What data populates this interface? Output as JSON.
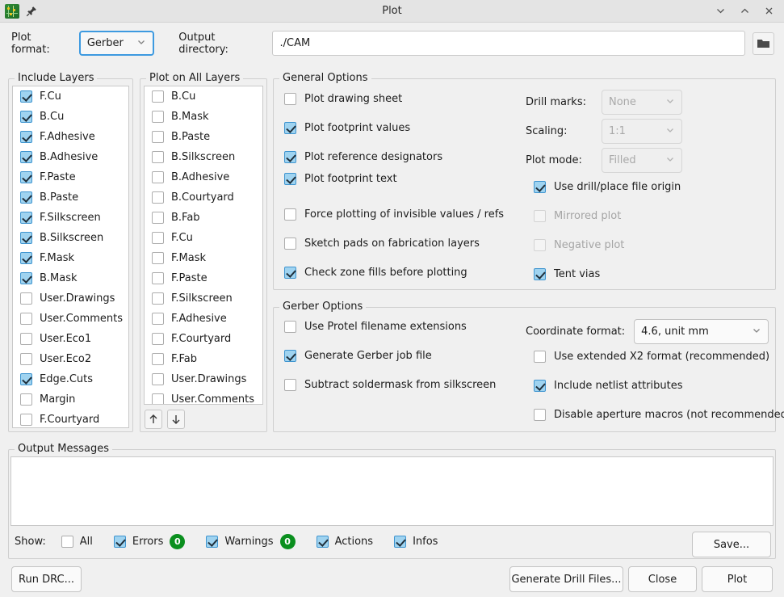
{
  "window": {
    "title": "Plot",
    "app_icon": "pcb-board-icon",
    "pin_icon": "pin-icon",
    "minimize_label": "chevron-down-icon",
    "maximize_label": "chevron-up-icon",
    "close_label": "close-icon"
  },
  "toprow": {
    "plot_format_label": "Plot format:",
    "plot_format_value": "Gerber",
    "output_dir_label": "Output directory:",
    "output_dir_value": "./CAM",
    "browse_icon": "folder-icon"
  },
  "include_layers": {
    "title": "Include Layers",
    "items": [
      {
        "label": "F.Cu",
        "checked": true
      },
      {
        "label": "B.Cu",
        "checked": true
      },
      {
        "label": "F.Adhesive",
        "checked": true
      },
      {
        "label": "B.Adhesive",
        "checked": true
      },
      {
        "label": "F.Paste",
        "checked": true
      },
      {
        "label": "B.Paste",
        "checked": true
      },
      {
        "label": "F.Silkscreen",
        "checked": true
      },
      {
        "label": "B.Silkscreen",
        "checked": true
      },
      {
        "label": "F.Mask",
        "checked": true
      },
      {
        "label": "B.Mask",
        "checked": true
      },
      {
        "label": "User.Drawings",
        "checked": false
      },
      {
        "label": "User.Comments",
        "checked": false
      },
      {
        "label": "User.Eco1",
        "checked": false
      },
      {
        "label": "User.Eco2",
        "checked": false
      },
      {
        "label": "Edge.Cuts",
        "checked": true
      },
      {
        "label": "Margin",
        "checked": false
      },
      {
        "label": "F.Courtyard",
        "checked": false
      }
    ]
  },
  "plot_on_all_layers": {
    "title": "Plot on All Layers",
    "items": [
      {
        "label": "B.Cu",
        "checked": false
      },
      {
        "label": "B.Mask",
        "checked": false
      },
      {
        "label": "B.Paste",
        "checked": false
      },
      {
        "label": "B.Silkscreen",
        "checked": false
      },
      {
        "label": "B.Adhesive",
        "checked": false
      },
      {
        "label": "B.Courtyard",
        "checked": false
      },
      {
        "label": "B.Fab",
        "checked": false
      },
      {
        "label": "F.Cu",
        "checked": false
      },
      {
        "label": "F.Mask",
        "checked": false
      },
      {
        "label": "F.Paste",
        "checked": false
      },
      {
        "label": "F.Silkscreen",
        "checked": false
      },
      {
        "label": "F.Adhesive",
        "checked": false
      },
      {
        "label": "F.Courtyard",
        "checked": false
      },
      {
        "label": "F.Fab",
        "checked": false
      },
      {
        "label": "User.Drawings",
        "checked": false
      },
      {
        "label": "User.Comments",
        "checked": false
      }
    ],
    "move_up_icon": "arrow-up-icon",
    "move_down_icon": "arrow-down-icon"
  },
  "general_options": {
    "title": "General Options",
    "left_checks": [
      {
        "label": "Plot drawing sheet",
        "checked": false,
        "disabled": false
      },
      {
        "label": "Plot footprint values",
        "checked": true,
        "disabled": false
      },
      {
        "label": "Plot reference designators",
        "checked": true,
        "disabled": false
      },
      {
        "label": "Plot footprint text",
        "checked": true,
        "disabled": false
      },
      {
        "label": "Force plotting of invisible values / refs",
        "checked": false,
        "disabled": false
      },
      {
        "label": "Sketch pads on fabrication layers",
        "checked": false,
        "disabled": false
      },
      {
        "label": "Check zone fills before plotting",
        "checked": true,
        "disabled": false
      }
    ],
    "selects": [
      {
        "label": "Drill marks:",
        "value": "None",
        "disabled": true
      },
      {
        "label": "Scaling:",
        "value": "1:1",
        "disabled": true
      },
      {
        "label": "Plot mode:",
        "value": "Filled",
        "disabled": true
      }
    ],
    "right_checks": [
      {
        "label": "Use drill/place file origin",
        "checked": true,
        "disabled": false
      },
      {
        "label": "Mirrored plot",
        "checked": false,
        "disabled": true
      },
      {
        "label": "Negative plot",
        "checked": false,
        "disabled": true
      },
      {
        "label": "Tent vias",
        "checked": true,
        "disabled": false
      }
    ]
  },
  "gerber_options": {
    "title": "Gerber Options",
    "left_checks": [
      {
        "label": "Use Protel filename extensions",
        "checked": false
      },
      {
        "label": "Generate Gerber job file",
        "checked": true
      },
      {
        "label": "Subtract soldermask from silkscreen",
        "checked": false
      }
    ],
    "coordinate_format_label": "Coordinate format:",
    "coordinate_format_value": "4.6, unit mm",
    "right_checks": [
      {
        "label": "Use extended X2 format (recommended)",
        "checked": false
      },
      {
        "label": "Include netlist attributes",
        "checked": true
      },
      {
        "label": "Disable aperture macros (not recommended)",
        "checked": false
      }
    ]
  },
  "output_messages": {
    "title": "Output Messages",
    "content": "",
    "show_label": "Show:",
    "filters": [
      {
        "label": "All",
        "checked": false,
        "badge": null
      },
      {
        "label": "Errors",
        "checked": true,
        "badge": "0"
      },
      {
        "label": "Warnings",
        "checked": true,
        "badge": "0"
      },
      {
        "label": "Actions",
        "checked": true,
        "badge": null
      },
      {
        "label": "Infos",
        "checked": true,
        "badge": null
      }
    ],
    "save_label": "Save..."
  },
  "footer": {
    "run_drc_label": "Run DRC...",
    "generate_drill_label": "Generate Drill Files...",
    "close_label": "Close",
    "plot_label": "Plot"
  },
  "colors": {
    "checkbox_accent": "#9fd3f0",
    "checkbox_border": "#3e94cf",
    "badge_green": "#0a8f1e",
    "focus_blue": "#3d9ae0",
    "window_bg": "#f0f0f0"
  }
}
